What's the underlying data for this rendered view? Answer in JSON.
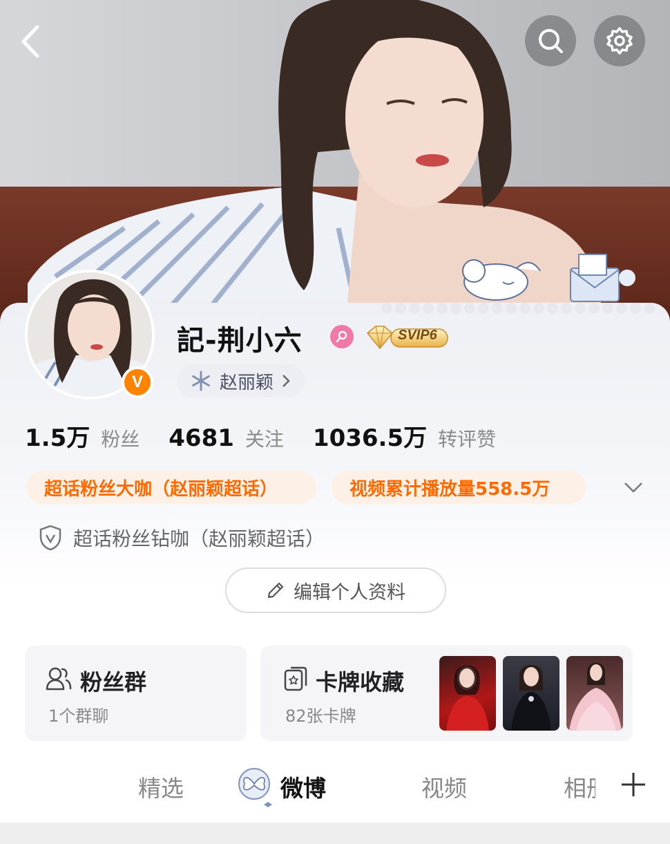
{
  "profile": {
    "username": "記-荆小六",
    "vip_label": "SVIP6",
    "verified_badge": "V",
    "super_topic_chip": "赵丽颖"
  },
  "stats": [
    {
      "value": "1.5万",
      "label": "粉丝"
    },
    {
      "value": "4681",
      "label": "关注"
    },
    {
      "value": "1036.5万",
      "label": "转评赞"
    }
  ],
  "tags": [
    "超话粉丝大咖（赵丽颖超话）",
    "视频累计播放量558.5万"
  ],
  "badge": "超话粉丝钻咖（赵丽颖超话）",
  "edit_button": "编辑个人资料",
  "fan_group": {
    "title": "粉丝群",
    "subtitle": "1个群聊"
  },
  "card_collection": {
    "title": "卡牌收藏",
    "subtitle": "82张卡牌"
  },
  "tabs": [
    "精选",
    "微博",
    "视频",
    "相册"
  ],
  "active_tab": "微博",
  "colors": {
    "accent_orange": "#ff6a00",
    "verified_orange": "#ff8200",
    "gender_pink": "#f07aa6"
  },
  "icons": [
    "back-icon",
    "search-icon",
    "gear-icon",
    "snowflake-icon",
    "chevron-right-icon",
    "chevron-down-icon",
    "shield-icon",
    "pencil-icon",
    "people-icon",
    "card-icon",
    "plus-icon"
  ]
}
